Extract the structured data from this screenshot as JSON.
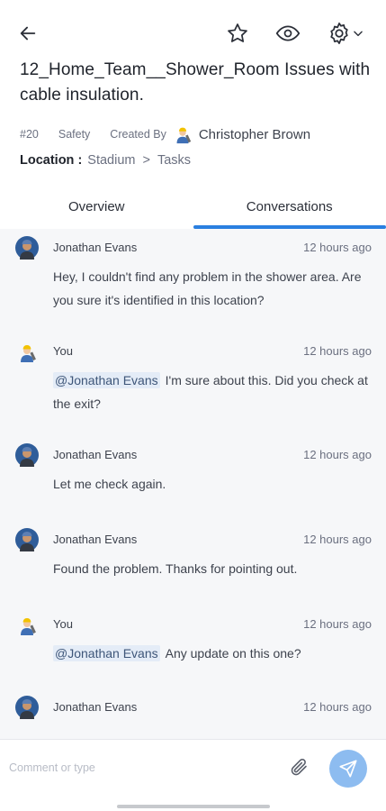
{
  "header": {
    "title": "12_Home_Team__Shower_Room Issues with cable insulation."
  },
  "meta": {
    "id": "#20",
    "category": "Safety",
    "created_by_label": "Created By",
    "creator_name": "Christopher Brown"
  },
  "location": {
    "label": "Location :",
    "path": [
      "Stadium",
      "Tasks"
    ],
    "separator": ">"
  },
  "tabs": [
    {
      "label": "Overview",
      "active": false
    },
    {
      "label": "Conversations",
      "active": true
    }
  ],
  "messages": [
    {
      "author": "Jonathan Evans",
      "time": "12 hours ago",
      "mention": "",
      "text": "Hey, I couldn't find any problem in the shower area. Are you sure it's identified in this location?",
      "avatar": "jonathan-avatar"
    },
    {
      "author": "You",
      "time": "12 hours ago",
      "mention": "@Jonathan Evans",
      "text": "I'm sure about this. Did you check at the exit?",
      "avatar": "worker-avatar"
    },
    {
      "author": "Jonathan Evans",
      "time": "12 hours ago",
      "mention": "",
      "text": "Let me check again.",
      "avatar": "jonathan-avatar"
    },
    {
      "author": "Jonathan Evans",
      "time": "12 hours ago",
      "mention": "",
      "text": "Found the problem. Thanks for pointing out.",
      "avatar": "jonathan-avatar"
    },
    {
      "author": "You",
      "time": "12 hours ago",
      "mention": "@Jonathan Evans",
      "text": "Any update on this one?",
      "avatar": "worker-avatar"
    },
    {
      "author": "Jonathan Evans",
      "time": "12 hours ago",
      "mention": "",
      "text": "",
      "avatar": "jonathan-avatar"
    }
  ],
  "composer": {
    "placeholder": "Comment or type"
  },
  "icons": {
    "back": "arrow-left-icon",
    "star": "star-icon",
    "watch": "eye-icon",
    "settings": "gear-icon",
    "attach": "paperclip-icon",
    "send": "send-icon"
  },
  "colors": {
    "accent": "#2a7fe0",
    "send_button": "#8dbcf0",
    "mention_bg": "#e4ecf7",
    "messages_bg": "#f6f7f9"
  }
}
